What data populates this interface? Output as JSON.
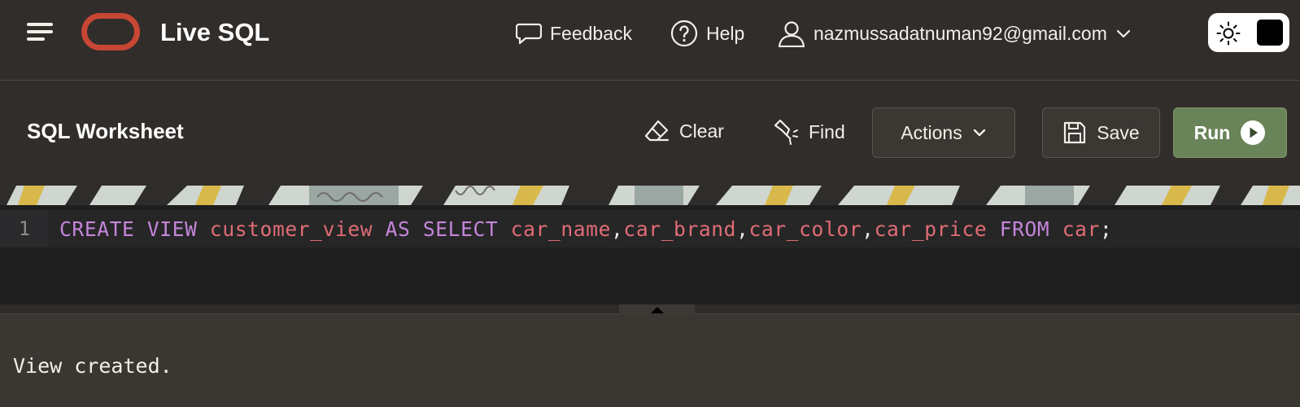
{
  "header": {
    "app_title": "Live SQL",
    "feedback_label": "Feedback",
    "help_label": "Help",
    "user_email": "nazmussadatnuman92@gmail.com",
    "brand_color": "#c74634"
  },
  "toolbar": {
    "title": "SQL Worksheet",
    "clear_label": "Clear",
    "find_label": "Find",
    "actions_label": "Actions",
    "save_label": "Save",
    "run_label": "Run"
  },
  "editor": {
    "line_number": "1",
    "tokens": [
      {
        "t": "CREATE VIEW",
        "c": "kw"
      },
      {
        "t": " ",
        "c": "pn"
      },
      {
        "t": "customer_view",
        "c": "id"
      },
      {
        "t": " ",
        "c": "pn"
      },
      {
        "t": "AS SELECT",
        "c": "kw"
      },
      {
        "t": " ",
        "c": "pn"
      },
      {
        "t": "car_name",
        "c": "id"
      },
      {
        "t": ",",
        "c": "pn"
      },
      {
        "t": "car_brand",
        "c": "id"
      },
      {
        "t": ",",
        "c": "pn"
      },
      {
        "t": "car_color",
        "c": "id"
      },
      {
        "t": ",",
        "c": "pn"
      },
      {
        "t": "car_price",
        "c": "id"
      },
      {
        "t": " ",
        "c": "pn"
      },
      {
        "t": "FROM",
        "c": "kw"
      },
      {
        "t": " ",
        "c": "pn"
      },
      {
        "t": "car",
        "c": "id"
      },
      {
        "t": ";",
        "c": "pn"
      }
    ]
  },
  "output": {
    "message": "View created."
  }
}
